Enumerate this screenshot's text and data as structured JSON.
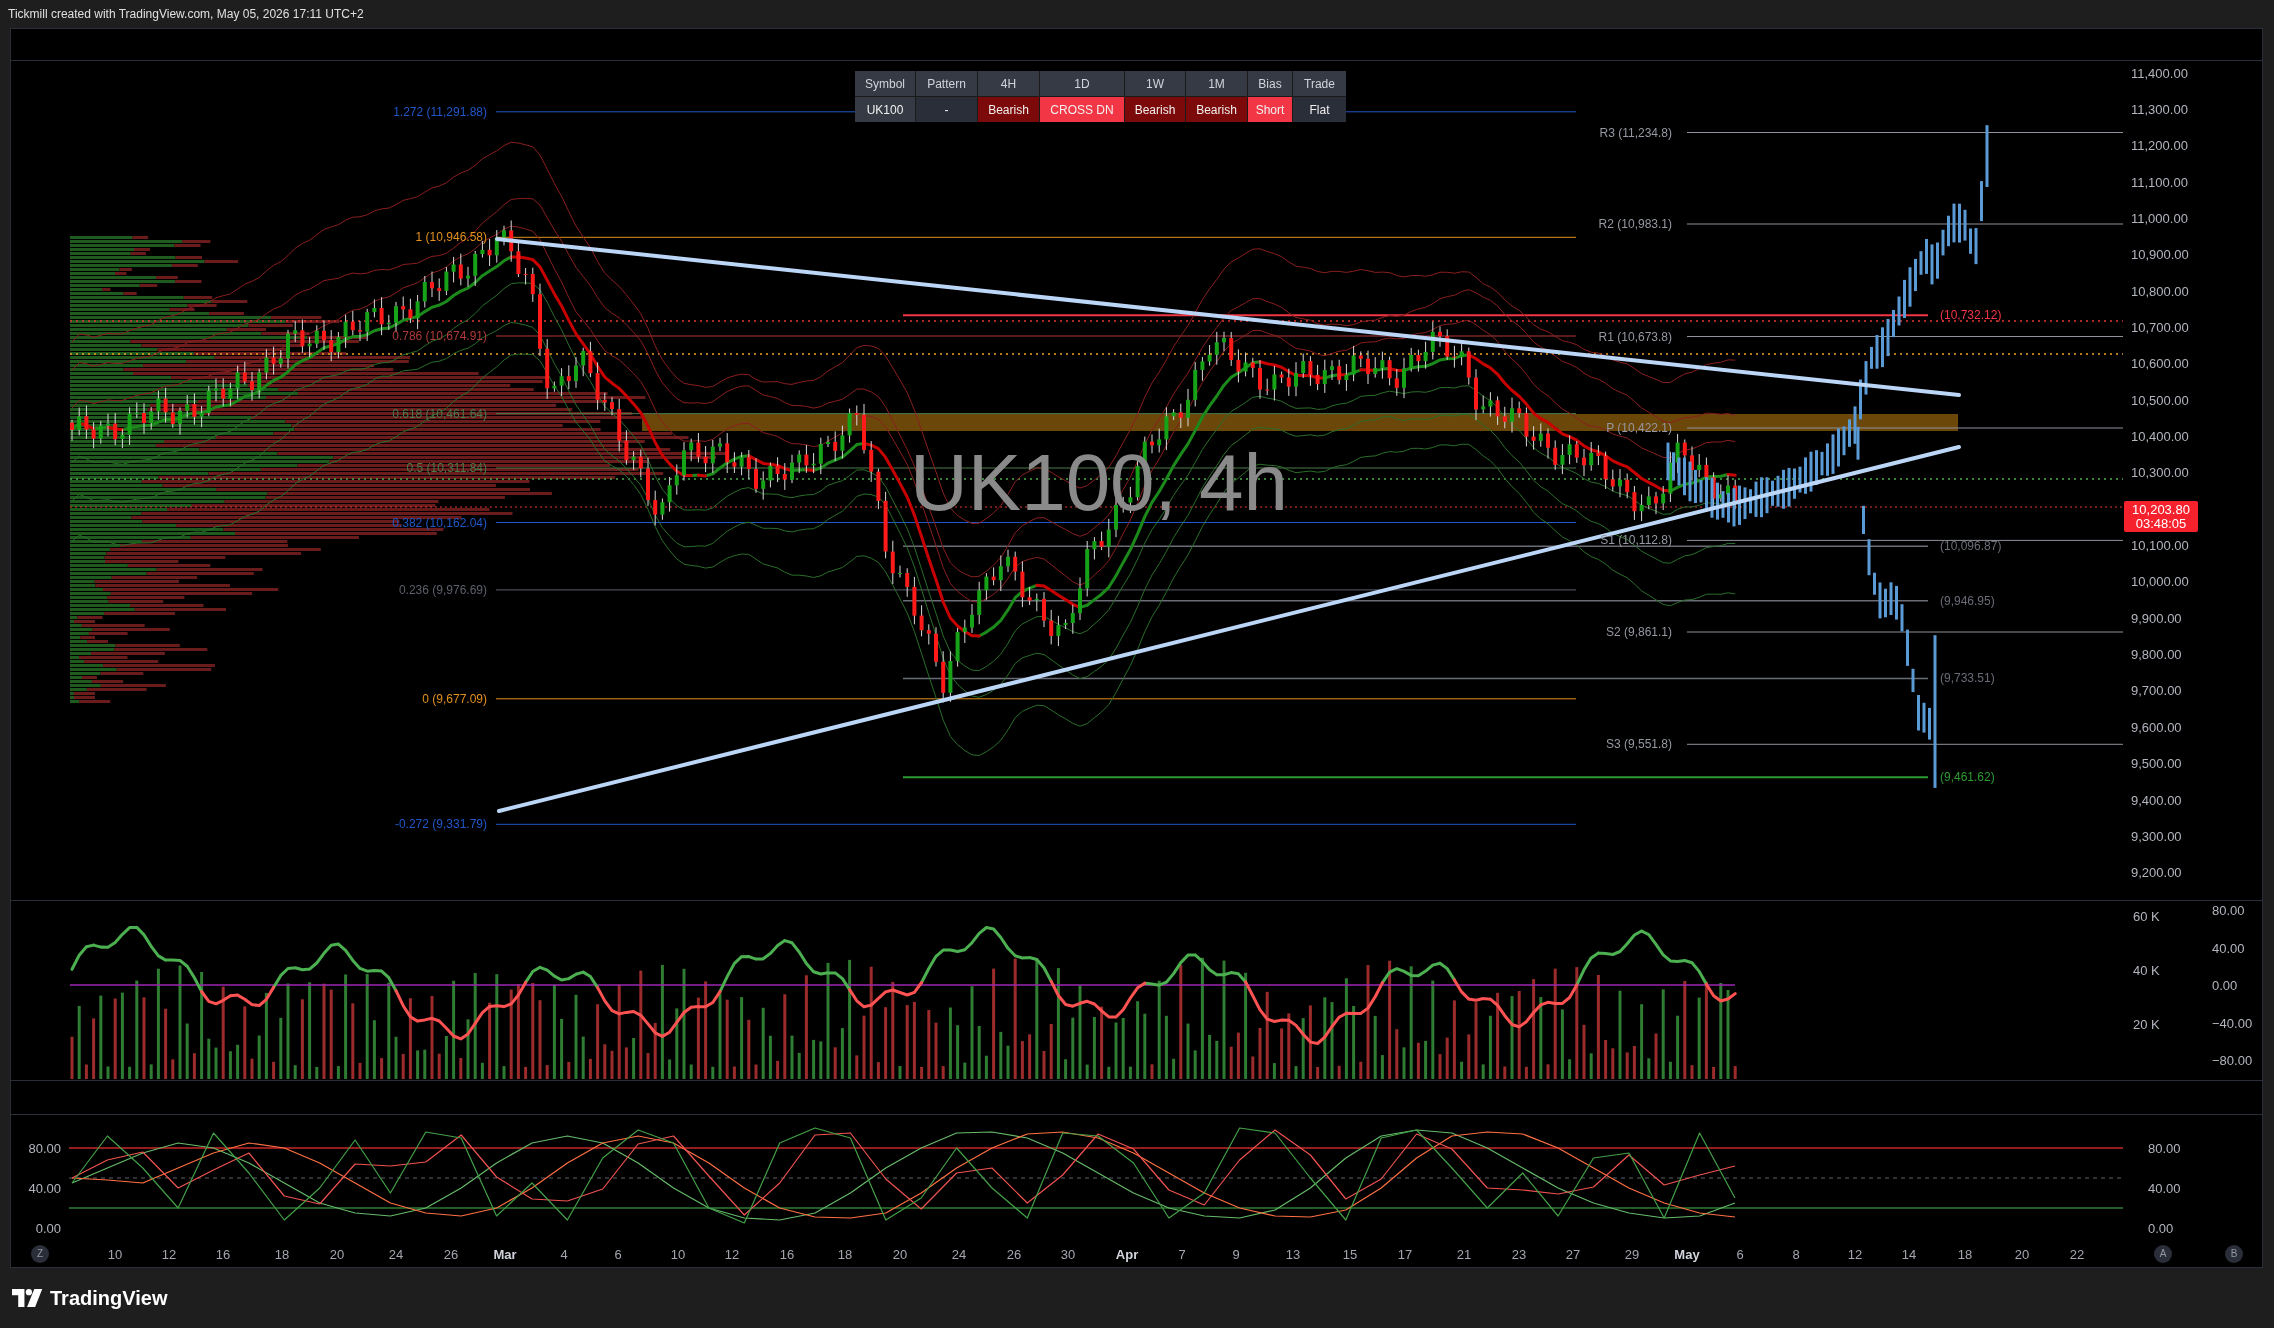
{
  "header": {
    "caption": "Tickmill created with TradingView.com, May 05, 2026 17:11 UTC+2"
  },
  "signal_table": {
    "columns": [
      "Symbol",
      "Pattern",
      "4H",
      "1D",
      "1W",
      "1M",
      "Bias",
      "Trade"
    ],
    "cells": [
      {
        "text": "UK100",
        "color": "#363a45"
      },
      {
        "text": "-",
        "color": "#2a2e39"
      },
      {
        "text": "Bearish",
        "color": "#7d0a0a"
      },
      {
        "text": "CROSS DN",
        "color": "#f23645"
      },
      {
        "text": "Bearish",
        "color": "#7d0a0a"
      },
      {
        "text": "Bearish",
        "color": "#7d0a0a"
      },
      {
        "text": "Short",
        "color": "#f23645"
      },
      {
        "text": "Flat",
        "color": "#2a2e39"
      }
    ]
  },
  "price_chart": {
    "watermark": "UK100, 4h",
    "fib_levels": [
      {
        "label": "1.272 (11,291.88)",
        "color": "#2157c9"
      },
      {
        "label": "1 (10,946.58)",
        "color": "#e3901d"
      },
      {
        "label": "0.786 (10,674.91)",
        "color": "#b23a3a"
      },
      {
        "label": "0.618 (10,461.64)",
        "color": "#4a7a4a"
      },
      {
        "label": "0.5 (10,311.84)",
        "color": "#4a7a4a"
      },
      {
        "label": "0.382 (10,162.04)",
        "color": "#2157c9"
      },
      {
        "label": "0.236 (9,976.69)",
        "color": "#5d606b"
      },
      {
        "label": "0 (9,677.09)",
        "color": "#e3901d"
      },
      {
        "label": "-0.272 (9,331.79)",
        "color": "#2157c9"
      }
    ],
    "pivot_levels": [
      "R3 (11,234.8)",
      "R2 (10,983.1)",
      "R1 (10,673.8)",
      "P (10,422.1)",
      "S1 (10,112.8)",
      "S2 (9,861.1)",
      "S3 (9,551.8)"
    ],
    "target_levels": [
      {
        "label": "(10,732.12)",
        "color": "#f23645"
      },
      {
        "label": "(10,096.87)",
        "color": "#6a6d78"
      },
      {
        "label": "(9,946.95)",
        "color": "#6a6d78"
      },
      {
        "label": "(9,733.51)",
        "color": "#6a6d78"
      },
      {
        "label": "(9,461.62)",
        "color": "#2e9b32"
      }
    ],
    "price_axis": [
      "11,400.00",
      "11,300.00",
      "11,200.00",
      "11,100.00",
      "11,000.00",
      "10,900.00",
      "10,800.00",
      "10,700.00",
      "10,600.00",
      "10,500.00",
      "10,400.00",
      "10,300.00",
      "10,100.00",
      "10,000.00",
      "9,900.00",
      "9,800.00",
      "9,700.00",
      "9,600.00",
      "9,500.00",
      "9,400.00",
      "9,300.00",
      "9,200.00"
    ],
    "last_price": {
      "price": "10,203.80",
      "countdown": "03:48:05"
    }
  },
  "volume_pane": {
    "volume_axis": [
      "60 K",
      "40 K",
      "20 K"
    ],
    "oscillator_axis": [
      "80.00",
      "40.00",
      "0.00",
      "−40.00",
      "−80.00"
    ]
  },
  "stochastic_pane": {
    "chart_data": {
      "type": "line",
      "ylim": [
        0,
        113
      ],
      "yticks": [
        {
          "value": 0,
          "label": "0.00"
        },
        {
          "value": 40,
          "label": "40.00"
        },
        {
          "value": 80,
          "label": "80.00"
        }
      ],
      "series": [
        {
          "color": "#66bb6a",
          "values": [
            45,
            60,
            75,
            85,
            80,
            65,
            45,
            25,
            15,
            12,
            20,
            40,
            65,
            85,
            92,
            85,
            65,
            40,
            20,
            10,
            8,
            15,
            35,
            60,
            80,
            95,
            96,
            90,
            75,
            55,
            35,
            20,
            12,
            10,
            18,
            40,
            70,
            92,
            98,
            95,
            80,
            60,
            40,
            25,
            15,
            10,
            12,
            25
          ]
        },
        {
          "color": "#ff7043",
          "values": [
            50,
            48,
            45,
            60,
            75,
            85,
            80,
            65,
            45,
            25,
            15,
            12,
            20,
            40,
            65,
            85,
            92,
            85,
            65,
            40,
            20,
            11,
            10,
            15,
            35,
            60,
            80,
            94,
            96,
            90,
            75,
            55,
            35,
            20,
            12,
            11,
            18,
            40,
            70,
            92,
            96,
            94,
            80,
            60,
            40,
            25,
            15,
            11
          ]
        },
        {
          "color": "#ef5350",
          "values": [
            50,
            68,
            76,
            40,
            58,
            75,
            32,
            24,
            64,
            62,
            66,
            93,
            51,
            29,
            27,
            39,
            84,
            92,
            52,
            13,
            45,
            93,
            95,
            49,
            19,
            55,
            60,
            25,
            53,
            94,
            79,
            38,
            23,
            68,
            98,
            73,
            29,
            49,
            94,
            79,
            40,
            38,
            34,
            41,
            73,
            43,
            53,
            62
          ]
        },
        {
          "color": "#43a047",
          "values": [
            45,
            92,
            60,
            20,
            95,
            55,
            8,
            40,
            88,
            35,
            96,
            90,
            12,
            45,
            8,
            70,
            98,
            85,
            20,
            5,
            85,
            100,
            90,
            8,
            30,
            80,
            40,
            10,
            95,
            92,
            65,
            10,
            35,
            100,
            95,
            50,
            8,
            90,
            98,
            60,
            20,
            55,
            12,
            70,
            75,
            10,
            95,
            30
          ]
        }
      ]
    },
    "right_axis": [
      "80.00",
      "40.00",
      "0.00"
    ]
  },
  "time_axis": {
    "left_button": "Z",
    "labels": [
      {
        "text": "10",
        "kind": "day"
      },
      {
        "text": "12",
        "kind": "day"
      },
      {
        "text": "16",
        "kind": "day"
      },
      {
        "text": "18",
        "kind": "day"
      },
      {
        "text": "20",
        "kind": "day"
      },
      {
        "text": "24",
        "kind": "day"
      },
      {
        "text": "26",
        "kind": "day"
      },
      {
        "text": "Mar",
        "kind": "month"
      },
      {
        "text": "4",
        "kind": "day"
      },
      {
        "text": "6",
        "kind": "day"
      },
      {
        "text": "10",
        "kind": "day"
      },
      {
        "text": "12",
        "kind": "day"
      },
      {
        "text": "16",
        "kind": "day"
      },
      {
        "text": "18",
        "kind": "day"
      },
      {
        "text": "20",
        "kind": "day"
      },
      {
        "text": "24",
        "kind": "day"
      },
      {
        "text": "26",
        "kind": "day"
      },
      {
        "text": "30",
        "kind": "day"
      },
      {
        "text": "Apr",
        "kind": "month"
      },
      {
        "text": "7",
        "kind": "day"
      },
      {
        "text": "9",
        "kind": "day"
      },
      {
        "text": "13",
        "kind": "day"
      },
      {
        "text": "15",
        "kind": "day"
      },
      {
        "text": "17",
        "kind": "day"
      },
      {
        "text": "21",
        "kind": "day"
      },
      {
        "text": "23",
        "kind": "day"
      },
      {
        "text": "27",
        "kind": "day"
      },
      {
        "text": "29",
        "kind": "day"
      },
      {
        "text": "May",
        "kind": "month"
      },
      {
        "text": "6",
        "kind": "day"
      },
      {
        "text": "8",
        "kind": "day"
      },
      {
        "text": "12",
        "kind": "day"
      },
      {
        "text": "14",
        "kind": "day"
      },
      {
        "text": "18",
        "kind": "day"
      },
      {
        "text": "20",
        "kind": "day"
      },
      {
        "text": "22",
        "kind": "day"
      }
    ],
    "right_buttons": [
      "A",
      "B"
    ]
  },
  "footer": {
    "logo_text": "TradingView"
  }
}
